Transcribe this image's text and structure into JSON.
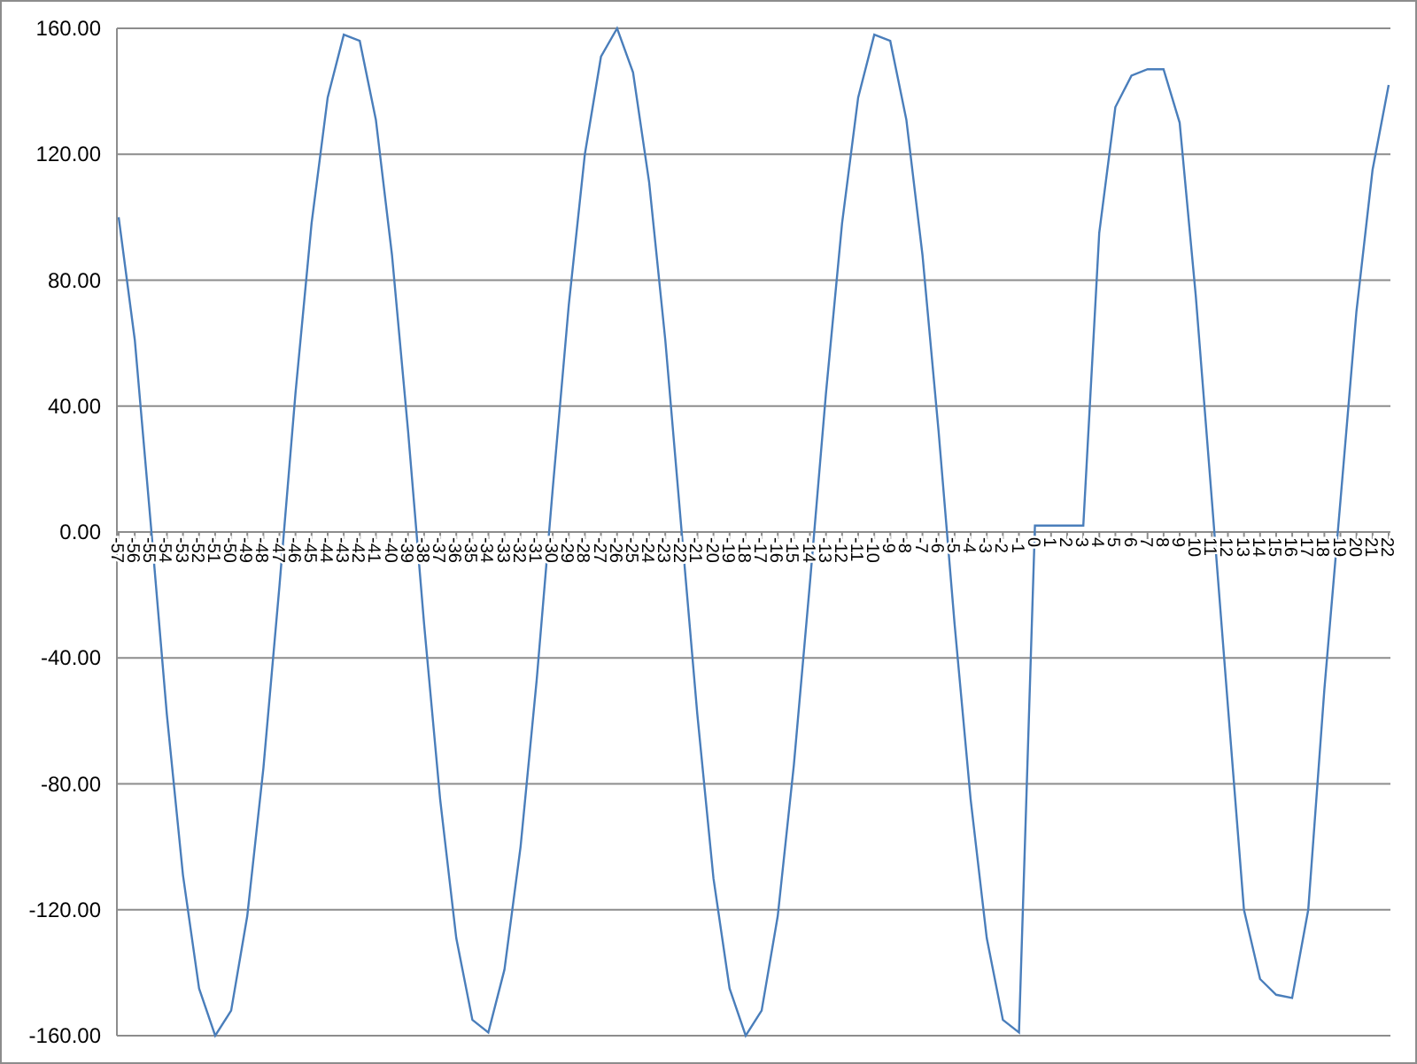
{
  "chart": {
    "chart_data": {
      "type": "line",
      "categories": [
        "-57",
        "-56",
        "-55",
        "-54",
        "-53",
        "-52",
        "-51",
        "-50",
        "-49",
        "-48",
        "-47",
        "-46",
        "-45",
        "-44",
        "-43",
        "-42",
        "-41",
        "-40",
        "-39",
        "-38",
        "-37",
        "-36",
        "-35",
        "-34",
        "-33",
        "-32",
        "-31",
        "-30",
        "-29",
        "-28",
        "-27",
        "-26",
        "-25",
        "-24",
        "-23",
        "-22",
        "-21",
        "-20",
        "-19",
        "-18",
        "-17",
        "-16",
        "-15",
        "-14",
        "-13",
        "-12",
        "-11",
        "-10",
        "-9",
        "-8",
        "-7",
        "-6",
        "-5",
        "-4",
        "-3",
        "-2",
        "-1",
        "0",
        "1",
        "2",
        "3",
        "4",
        "5",
        "6",
        "7",
        "8",
        "9",
        "10",
        "11",
        "12",
        "13",
        "14",
        "15",
        "16",
        "17",
        "18",
        "19",
        "20",
        "21",
        "22"
      ],
      "grid": true,
      "series": [
        {
          "color": "#4a7ebb",
          "values": [
            100,
            61,
            2,
            -58,
            -109,
            -145,
            -160,
            -152,
            -122,
            -75,
            -17,
            44,
            98,
            138,
            158,
            156,
            131,
            88,
            32,
            -29,
            -85,
            -129,
            -155,
            -159,
            -139,
            -100,
            -47,
            14,
            72,
            120,
            151,
            160,
            146,
            111,
            61,
            1,
            -58,
            -110,
            -145,
            -160,
            -152,
            -122,
            -74,
            -16,
            44,
            98,
            138,
            158,
            156,
            131,
            88,
            32,
            -29,
            -85,
            -129,
            -155,
            -159,
            2,
            2,
            2,
            2,
            95,
            135,
            145,
            147,
            147,
            130,
            75,
            10,
            -55,
            -120,
            -142,
            -147,
            -148,
            -120,
            -50,
            10,
            70,
            115,
            142
          ]
        }
      ],
      "ylim": [
        -160,
        160
      ],
      "yticks": [
        {
          "value": -160,
          "label": "-160.00"
        },
        {
          "value": -120,
          "label": "-120.00"
        },
        {
          "value": -80,
          "label": "-80.00"
        },
        {
          "value": -40,
          "label": "-40.00"
        },
        {
          "value": 0,
          "label": "0.00"
        },
        {
          "value": 40,
          "label": "40.00"
        },
        {
          "value": 80,
          "label": "80.00"
        },
        {
          "value": 120,
          "label": "120.00"
        },
        {
          "value": 160,
          "label": "160.00"
        }
      ]
    }
  }
}
